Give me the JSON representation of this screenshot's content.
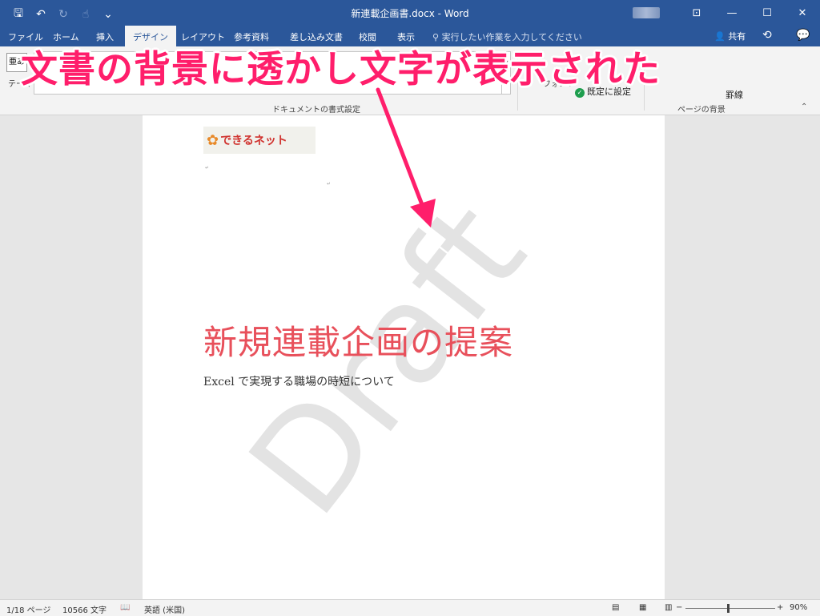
{
  "window": {
    "title": "新連載企画書.docx  -  Word"
  },
  "qat": {
    "save_icon": "save-icon",
    "undo_icon": "undo-icon",
    "redo_icon": "redo-icon",
    "touch_icon": "touch-mode-icon",
    "customize_icon": "customize-icon"
  },
  "tabs": [
    {
      "label": "ファイル"
    },
    {
      "label": "ホーム"
    },
    {
      "label": "挿入"
    },
    {
      "label": "デザイン",
      "active": true
    },
    {
      "label": "レイアウト"
    },
    {
      "label": "参考資料"
    },
    {
      "label": "差し込み文書"
    },
    {
      "label": "校閲"
    },
    {
      "label": "表示"
    }
  ],
  "tellme": "実行したい作業を入力してください",
  "share_label": "共有",
  "ribbon": {
    "theme_label": "テーマ",
    "theme_glyph": "亜あ",
    "group_doc_format": "ドキュメントの書式設定",
    "font_label": "フォント",
    "default_label": "既定に設定",
    "border_label": "罫線",
    "group_page_bg": "ページの背景"
  },
  "document": {
    "logo_text": "できるネット",
    "watermark": "Draft",
    "title": "新規連載企画の提案",
    "subtitle": "Excel で実現する職場の時短について"
  },
  "status": {
    "page": "1/18 ページ",
    "words": "10566 文字",
    "language": "英語 (米国)",
    "zoom": "90%"
  },
  "annotation": {
    "text": "文書の背景に透かし文字が表示された"
  },
  "colors": {
    "word_blue": "#2b579a",
    "annotation": "#ff1e6b",
    "doc_title": "#e8505b"
  }
}
